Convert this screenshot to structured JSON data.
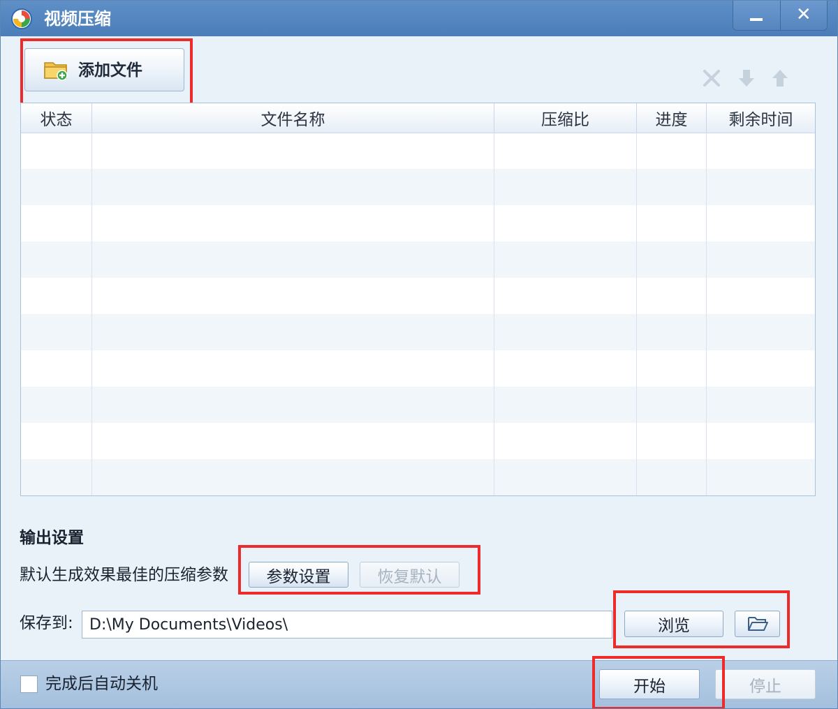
{
  "window": {
    "title": "视频压缩",
    "minimize_label": "_",
    "close_label": "✕"
  },
  "toolbar": {
    "add_file_label": "添加文件",
    "list_tools": [
      "delete-icon",
      "move-down-icon",
      "move-up-icon"
    ]
  },
  "table": {
    "columns": [
      "状态",
      "文件名称",
      "压缩比",
      "进度",
      "剩余时间"
    ],
    "rows": []
  },
  "output": {
    "section_title": "输出设置",
    "description": "默认生成效果最佳的压缩参数",
    "param_settings_label": "参数设置",
    "restore_default_label": "恢复默认",
    "save_to_label": "保存到:",
    "save_path": "D:\\My Documents\\Videos\\",
    "browse_label": "浏览",
    "open_folder_icon": "folder-open-icon"
  },
  "bottom": {
    "shutdown_label": "完成后自动关机",
    "shutdown_checked": false,
    "start_label": "开始",
    "stop_label": "停止"
  },
  "colors": {
    "titlebar": "#4f80bb",
    "highlight_box": "#ee2b2b",
    "window_bg": "#e9f1f9"
  }
}
